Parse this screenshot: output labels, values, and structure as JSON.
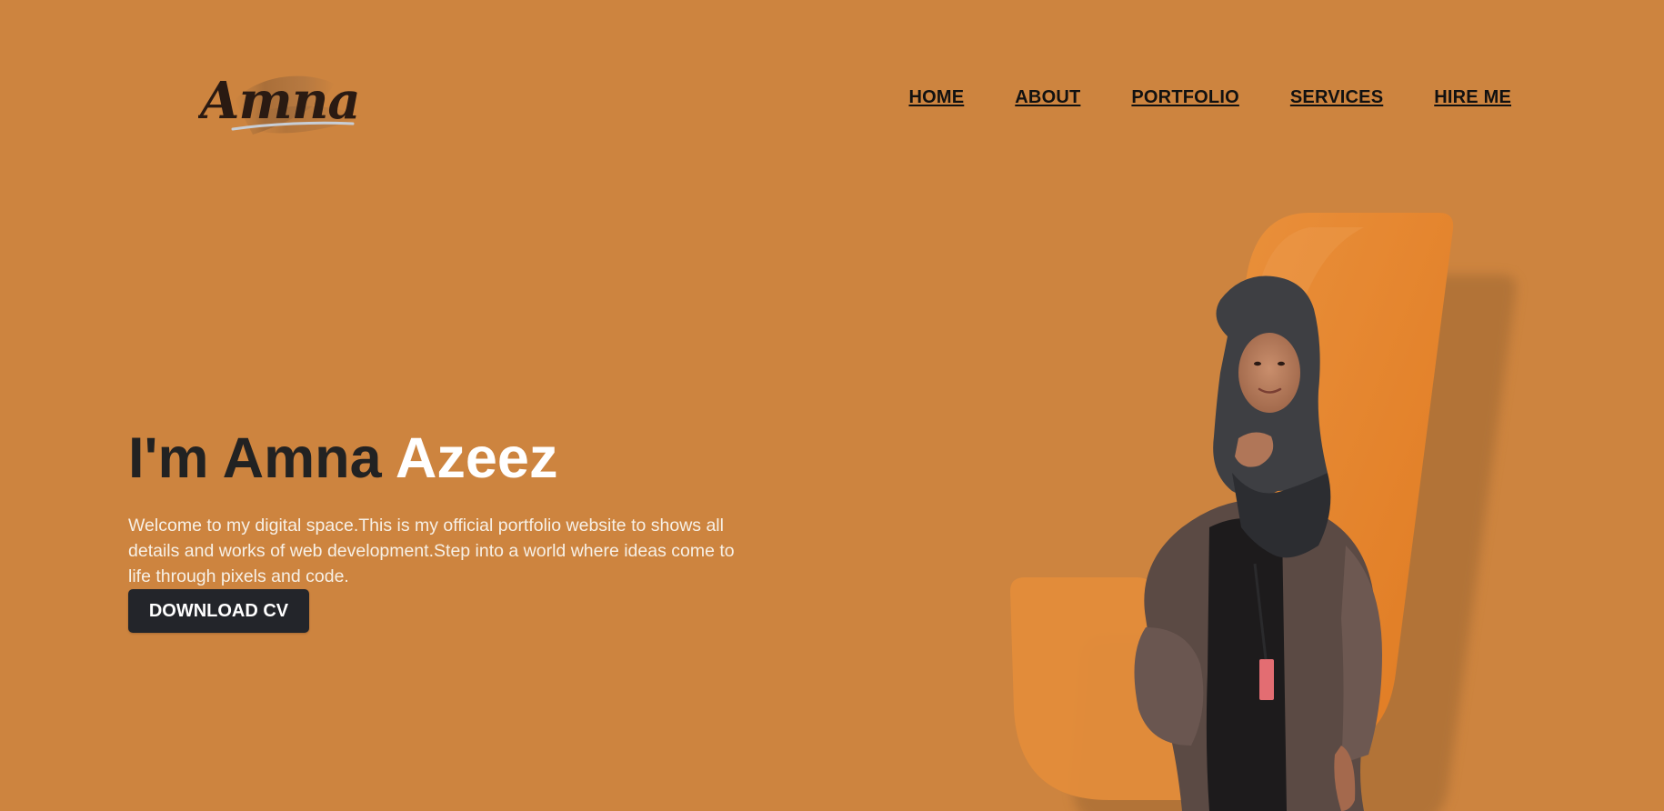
{
  "header": {
    "logo_text": "Amna",
    "nav": [
      {
        "label": "HOME"
      },
      {
        "label": "ABOUT"
      },
      {
        "label": "PORTFOLIO"
      },
      {
        "label": "SERVICES"
      },
      {
        "label": "HIRE ME"
      }
    ]
  },
  "hero": {
    "title_prefix": "I'm Amna ",
    "title_accent": "Azeez",
    "description": "Welcome to my digital space.This is my official portfolio website to shows all details and works of web development.Step into a world where ideas come to life through pixels and code.",
    "cta_label": "DOWNLOAD CV"
  },
  "colors": {
    "background": "#cd843f",
    "accent_shape": "#e8852b",
    "button": "#23252a",
    "title_dark": "#222222",
    "title_accent": "#ffffff"
  },
  "icons": {
    "logo": "signature-logo",
    "portrait": "profile-photo"
  }
}
